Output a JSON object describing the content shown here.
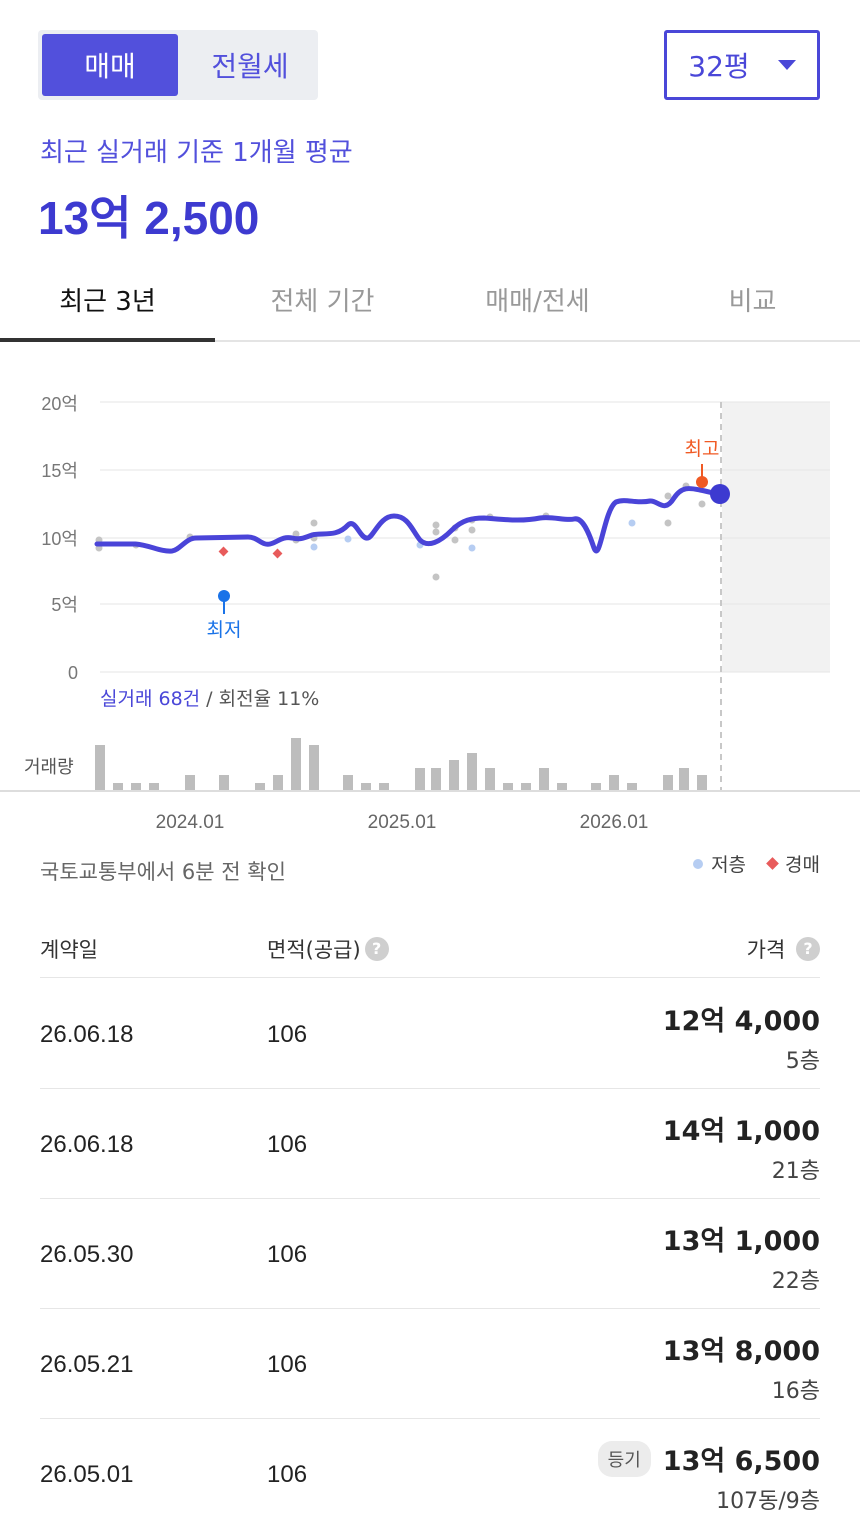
{
  "segment": {
    "active": "매매",
    "inactive": "전월세"
  },
  "size_select": {
    "label": "32평"
  },
  "average": {
    "label": "최근 실거래 기준 1개월 평균",
    "value": "13억 2,500"
  },
  "tabs": [
    {
      "label": "최근 3년",
      "active": true
    },
    {
      "label": "전체 기간",
      "active": false
    },
    {
      "label": "매매/전세",
      "active": false
    },
    {
      "label": "비교",
      "active": false
    }
  ],
  "chart": {
    "y_ticks": [
      "20억",
      "15억",
      "10억",
      "5억",
      "0"
    ],
    "x_ticks": [
      "2024.01",
      "2025.01",
      "2026.01"
    ],
    "high_label": "최고",
    "low_label": "최저",
    "trade_count": "실거래 68건",
    "turnover": " / 회전율 11%",
    "volume_label": "거래량"
  },
  "colors": {
    "primary": "#3d3ad0",
    "high": "#f05a24",
    "low": "#1a73e8",
    "low_floor": "#b6cdf2",
    "auction": "#e85b5b"
  },
  "source": "국토교통부에서 6분 전 확인",
  "legend": {
    "low_floor": "저층",
    "auction": "경매"
  },
  "table": {
    "headers": {
      "date": "계약일",
      "area": "면적(공급)",
      "price": "가격"
    },
    "rows": [
      {
        "date": "26.06.18",
        "area": "106",
        "price": "12억 4,000",
        "floor": "5층",
        "badge": ""
      },
      {
        "date": "26.06.18",
        "area": "106",
        "price": "14억 1,000",
        "floor": "21층",
        "badge": ""
      },
      {
        "date": "26.05.30",
        "area": "106",
        "price": "13억 1,000",
        "floor": "22층",
        "badge": ""
      },
      {
        "date": "26.05.21",
        "area": "106",
        "price": "13억 8,000",
        "floor": "16층",
        "badge": ""
      },
      {
        "date": "26.05.01",
        "area": "106",
        "price": "13억 6,500",
        "floor": "107동/9층",
        "badge": "등기"
      }
    ]
  }
}
